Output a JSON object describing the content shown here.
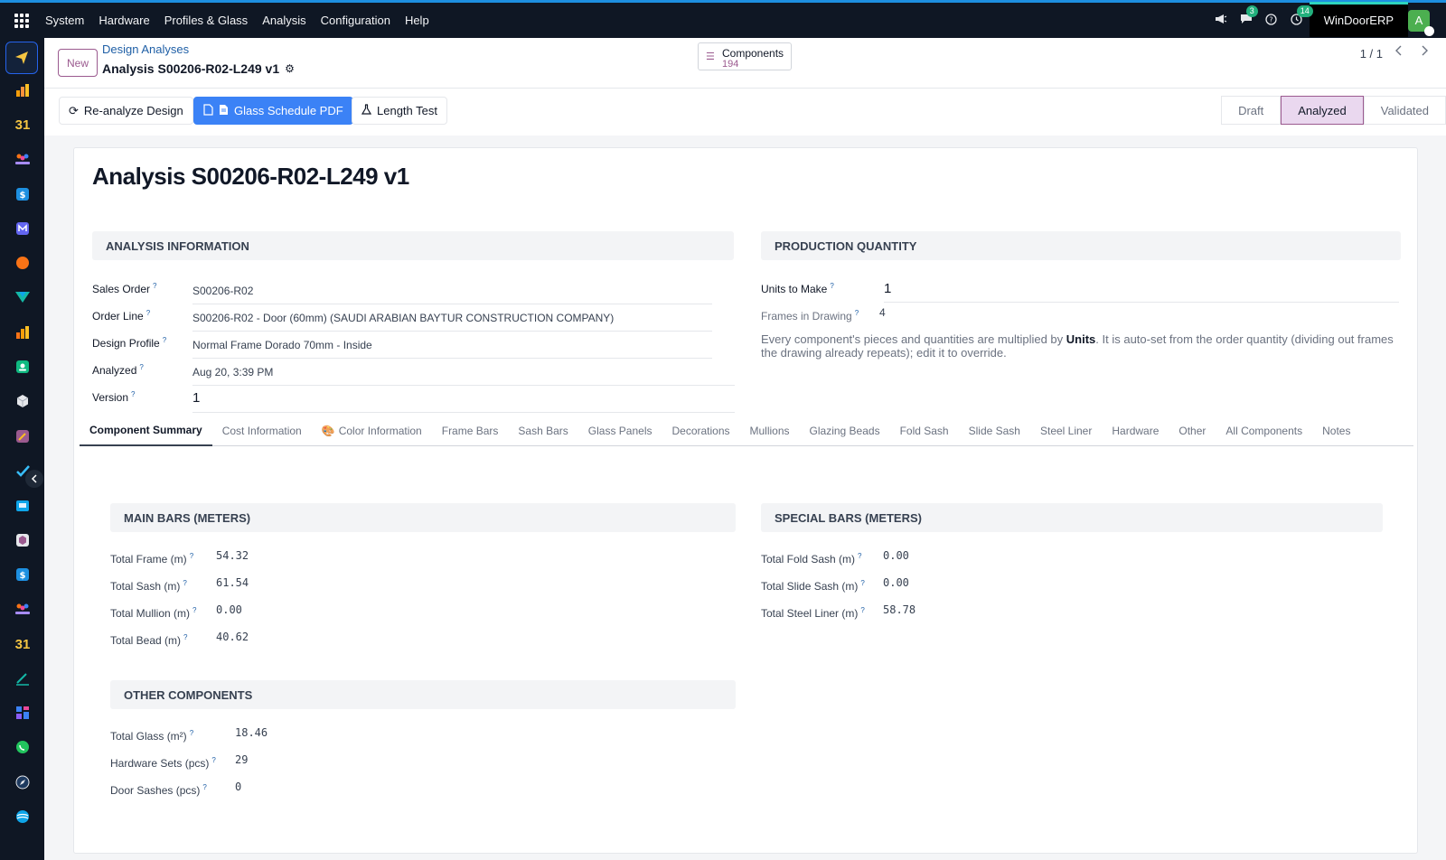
{
  "topbar": {
    "menu": [
      "System",
      "Hardware",
      "Profiles & Glass",
      "Analysis",
      "Configuration",
      "Help"
    ],
    "chat_count": "3",
    "activity_count": "14",
    "company": "WinDoorERP",
    "avatar_letter": "A"
  },
  "sidebar": {
    "calendar_label": "31",
    "calendar_label_2": "31"
  },
  "control": {
    "new_label": "New",
    "breadcrumb": "Design Analyses",
    "record_name": "Analysis S00206-R02-L249 v1",
    "smart_button": {
      "label": "Components",
      "value": "194"
    },
    "pager": "1 / 1"
  },
  "actions": {
    "reanalyze": "Re-analyze Design",
    "glass_pdf": "Glass Schedule PDF",
    "length_test": "Length Test"
  },
  "status": {
    "states": [
      "Draft",
      "Analyzed",
      "Validated"
    ],
    "current": "Analyzed"
  },
  "form": {
    "title": "Analysis S00206-R02-L249 v1",
    "analysis_info": {
      "header": "Analysis Information",
      "sales_order_label": "Sales Order",
      "sales_order": "S00206-R02",
      "order_line_label": "Order Line",
      "order_line": "S00206-R02 - Door (60mm) (SAUDI ARABIAN BAYTUR CONSTRUCTION COMPANY)",
      "design_profile_label": "Design Profile",
      "design_profile": "Normal Frame Dorado 70mm - Inside",
      "analyzed_label": "Analyzed",
      "analyzed": "Aug 20, 3:39 PM",
      "version_label": "Version",
      "version": "1"
    },
    "production": {
      "header": "Production Quantity",
      "units_label": "Units to Make",
      "units": "1",
      "frames_label": "Frames in Drawing",
      "frames": "4",
      "help_prefix": "Every component's pieces and quantities are multiplied by ",
      "help_bold": "Units",
      "help_suffix": ". It is auto-set from the order quantity (dividing out frames the drawing already repeats); edit it to override."
    }
  },
  "tabs": [
    "Component Summary",
    "Cost Information",
    "Color Information",
    "Frame Bars",
    "Sash Bars",
    "Glass Panels",
    "Decorations",
    "Mullions",
    "Glazing Beads",
    "Fold Sash",
    "Slide Sash",
    "Steel Liner",
    "Hardware",
    "Other",
    "All Components",
    "Notes"
  ],
  "summary": {
    "main_bars": {
      "header": "Main Bars (Meters)",
      "rows": [
        {
          "label": "Total Frame (m)",
          "value": "54.32"
        },
        {
          "label": "Total Sash (m)",
          "value": "61.54"
        },
        {
          "label": "Total Mullion (m)",
          "value": "0.00"
        },
        {
          "label": "Total Bead (m)",
          "value": "40.62"
        }
      ]
    },
    "special_bars": {
      "header": "Special Bars (Meters)",
      "rows": [
        {
          "label": "Total Fold Sash (m)",
          "value": "0.00"
        },
        {
          "label": "Total Slide Sash (m)",
          "value": "0.00"
        },
        {
          "label": "Total Steel Liner (m)",
          "value": "58.78"
        }
      ]
    },
    "other": {
      "header": "Other Components",
      "rows": [
        {
          "label": "Total Glass (m²)",
          "value": "18.46"
        },
        {
          "label": "Hardware Sets (pcs)",
          "value": "29"
        },
        {
          "label": "Door Sashes (pcs)",
          "value": "0"
        }
      ]
    }
  },
  "colors": {
    "accent": "#9b5a8f",
    "primary": "#3b82f6",
    "navbar": "#0f1724"
  }
}
